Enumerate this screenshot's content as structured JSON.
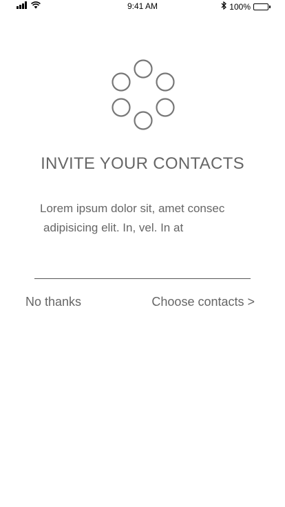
{
  "status_bar": {
    "time": "9:41 AM",
    "battery_percent": "100%",
    "icons": [
      "signal-icon",
      "wifi-icon",
      "bluetooth-icon",
      "battery-icon"
    ]
  },
  "loader": {
    "icon": "loading-spinner-icon",
    "color": "#666666"
  },
  "main": {
    "title": "INVITE YOUR CONTACTS",
    "body_line1": "Lorem ipsum dolor sit, amet consec",
    "body_line2": "adipisicing elit. In, vel. In at"
  },
  "actions": {
    "no_thanks_label": "No thanks",
    "choose_contacts_label": "Choose contacts >"
  },
  "colors": {
    "text": "#666666",
    "background": "#ffffff",
    "divider": "#555555"
  }
}
